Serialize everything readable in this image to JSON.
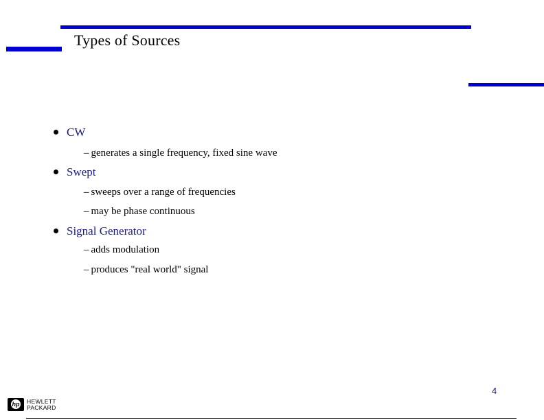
{
  "slide": {
    "title": "Types of Sources",
    "page_number": "4",
    "accent_color": "#0000d0",
    "heading_color": "#1a1a8c"
  },
  "items": [
    {
      "label": "CW",
      "subitems": [
        "generates a single frequency, fixed sine wave"
      ]
    },
    {
      "label": "Swept",
      "subitems": [
        "sweeps over a range of frequencies",
        "may be phase continuous"
      ]
    },
    {
      "label": "Signal Generator",
      "subitems": [
        "adds modulation",
        "produces \"real world\" signal"
      ]
    }
  ],
  "footer": {
    "logo_mark": "hp",
    "logo_line1": "HEWLETT",
    "logo_line2": "PACKARD",
    "dash": "–"
  }
}
